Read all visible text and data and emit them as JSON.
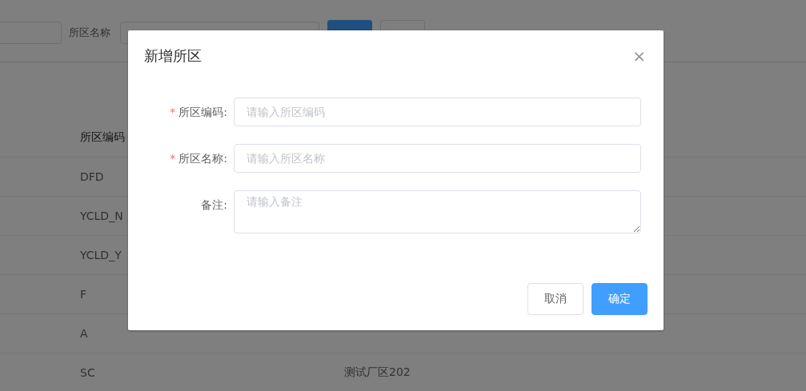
{
  "filter_bar": {
    "name_label": "所区名称",
    "buttons": [
      {
        "kind": "primary"
      },
      {
        "kind": "default"
      }
    ]
  },
  "table": {
    "columns": [
      "所区编码"
    ],
    "rows": [
      {
        "cells": [
          "DFD"
        ]
      },
      {
        "cells": [
          "YCLD_N"
        ]
      },
      {
        "cells": [
          "YCLD_Y"
        ]
      },
      {
        "cells": [
          "F"
        ]
      },
      {
        "cells": [
          "A"
        ]
      },
      {
        "cells": [
          "SC",
          "测试厂区202"
        ]
      }
    ]
  },
  "dialog": {
    "title": "新增所区",
    "close": "×",
    "required_mark": "*",
    "fields": [
      {
        "label": "所区编码:",
        "required": true,
        "kind": "input",
        "placeholder": "请输入所区编码"
      },
      {
        "label": "所区名称:",
        "required": true,
        "kind": "input",
        "placeholder": "请输入所区名称"
      },
      {
        "label": "备注:",
        "required": false,
        "kind": "textarea",
        "placeholder": "请输入备注"
      }
    ],
    "buttons": [
      {
        "label": "取消",
        "kind": "default"
      },
      {
        "label": "确定",
        "kind": "primary"
      }
    ]
  }
}
